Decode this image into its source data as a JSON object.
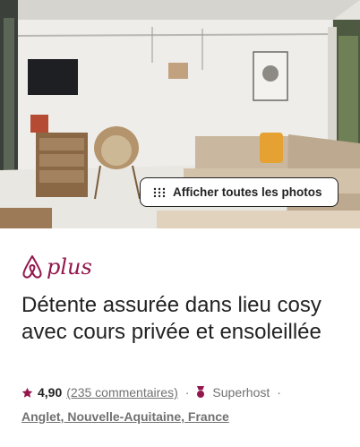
{
  "hero": {
    "show_all_photos_label": "Afficher toutes les photos"
  },
  "brand": {
    "label": "plus",
    "color": "#92174D"
  },
  "listing": {
    "title": "Détente assurée dans lieu cosy avec cours privée et ensoleillée",
    "rating": "4,90",
    "reviews": "(235 commentaires)",
    "separator": "·",
    "badge": "Superhost",
    "location": "Anglet, Nouvelle-Aquitaine, France"
  },
  "icons": {
    "star": "star-icon",
    "medal": "superhost-medal-icon",
    "grid": "grid-dots-icon",
    "logo": "airbnb-belo-logo"
  },
  "colors": {
    "accent": "#92174D",
    "text": "#222222",
    "muted": "#717171"
  }
}
